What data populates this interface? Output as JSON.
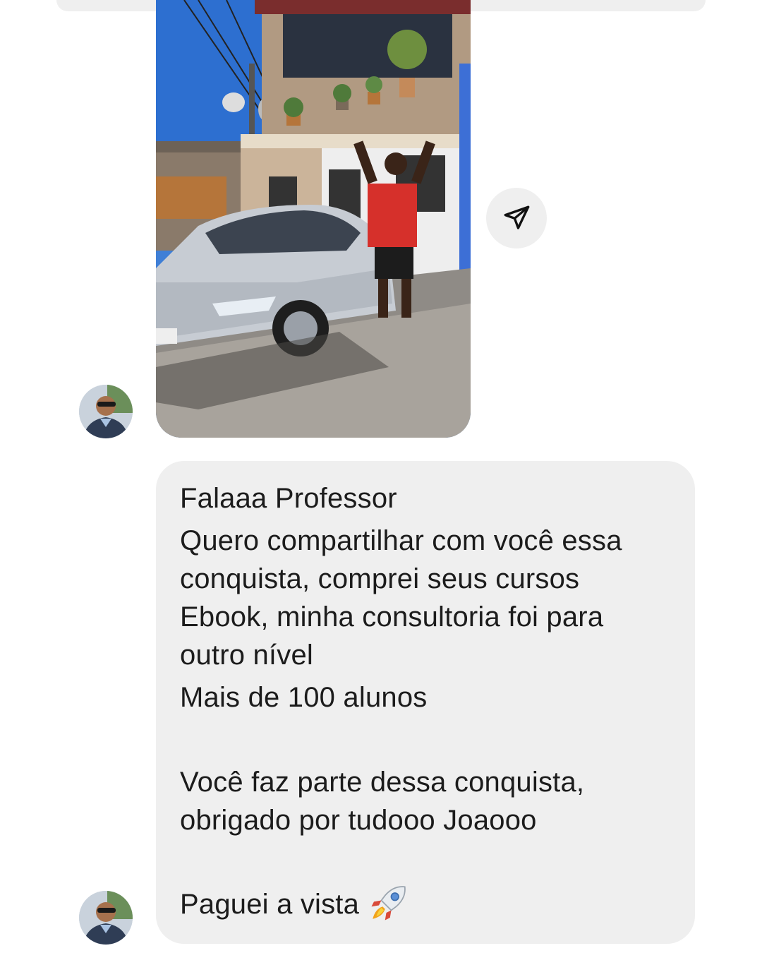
{
  "conversation": {
    "photo_message": {
      "image_description_icon": "photo-of-man-with-silver-car"
    },
    "share_button": {
      "icon": "paper-plane-icon"
    },
    "text_message": {
      "greeting": "Falaaa Professor",
      "main_paragraph": "Quero compartilhar com você essa conquista, comprei seus cursos Ebook, minha consultoria foi para outro nível",
      "students_line": "Mais de 100 alunos",
      "thanks_paragraph": "Você faz parte dessa conquista, obrigado por tudooo Joaooo",
      "paid_line": "Paguei a vista",
      "emoji": "rocket-icon"
    },
    "colors": {
      "bubble_background": "#efefef",
      "text": "#1c1c1c",
      "background": "#ffffff"
    }
  }
}
